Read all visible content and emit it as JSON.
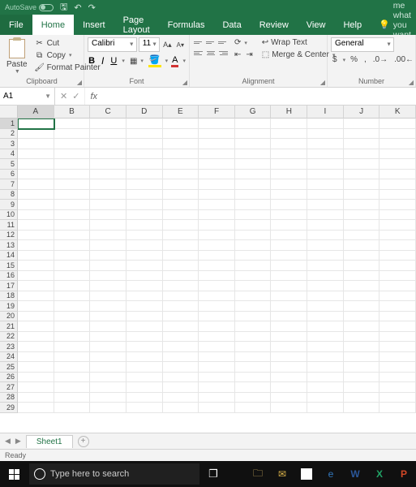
{
  "titlebar": {
    "autosave_label": "AutoSave"
  },
  "tabs": {
    "file": "File",
    "home": "Home",
    "insert": "Insert",
    "page_layout": "Page Layout",
    "formulas": "Formulas",
    "data": "Data",
    "review": "Review",
    "view": "View",
    "help": "Help",
    "tell_me": "Tell me what you want to do"
  },
  "ribbon": {
    "clipboard": {
      "label": "Clipboard",
      "paste": "Paste",
      "cut": "Cut",
      "copy": "Copy",
      "format_painter": "Format Painter"
    },
    "font": {
      "label": "Font",
      "name": "Calibri",
      "size": "11",
      "bold": "B",
      "italic": "I",
      "underline": "U",
      "fontcolor_glyph": "A",
      "fill_glyph": "◧"
    },
    "alignment": {
      "label": "Alignment",
      "wrap": "Wrap Text",
      "merge": "Merge & Center"
    },
    "number": {
      "label": "Number",
      "format": "General",
      "currency": "$",
      "percent": "%",
      "comma": ","
    }
  },
  "fbar": {
    "cellref": "A1",
    "cancel": "✕",
    "enter": "✓",
    "fx": "fx",
    "formula": ""
  },
  "grid": {
    "cols": [
      "A",
      "B",
      "C",
      "D",
      "E",
      "F",
      "G",
      "H",
      "I",
      "J",
      "K"
    ],
    "rows": [
      "1",
      "2",
      "3",
      "4",
      "5",
      "6",
      "7",
      "8",
      "9",
      "10",
      "11",
      "12",
      "13",
      "14",
      "15",
      "16",
      "17",
      "18",
      "19",
      "20",
      "21",
      "22",
      "23",
      "24",
      "25",
      "26",
      "27",
      "28",
      "29"
    ]
  },
  "ws": {
    "sheet1": "Sheet1",
    "add": "+"
  },
  "status": {
    "ready": "Ready"
  },
  "taskbar": {
    "search_placeholder": "Type here to search"
  }
}
